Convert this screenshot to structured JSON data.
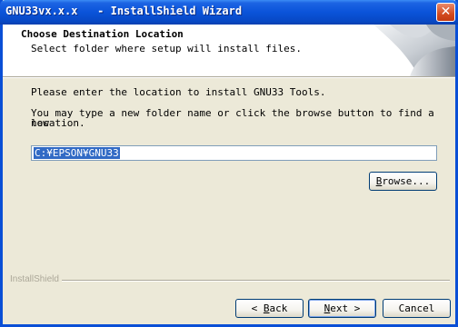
{
  "window": {
    "title": "GNU33vx.x.x   - InstallShield Wizard",
    "close_symbol": "✕"
  },
  "header": {
    "title": "Choose Destination Location",
    "subtitle": "Select folder where setup will install files."
  },
  "body": {
    "line1": "Please enter the location to install GNU33 Tools.",
    "line2a": "You may type a new folder name or click the browse button to find a new",
    "line2b": "location.",
    "path_value": "C:¥EPSON¥GNU33"
  },
  "buttons": {
    "browse": {
      "pre": "",
      "accel": "B",
      "post": "rowse..."
    },
    "back": {
      "pre": "< ",
      "accel": "B",
      "post": "ack"
    },
    "next": {
      "pre": "",
      "accel": "N",
      "post": "ext >"
    },
    "cancel": "Cancel"
  },
  "footer": {
    "brand": "InstallShield"
  },
  "colors": {
    "titlebar": "#0a53d9",
    "window_bg": "#ece9d8",
    "selection": "#316ac5",
    "close_button": "#d34b1f"
  },
  "icons": {
    "header_art": "wizard-header-graphic-icon",
    "close": "close-icon"
  }
}
